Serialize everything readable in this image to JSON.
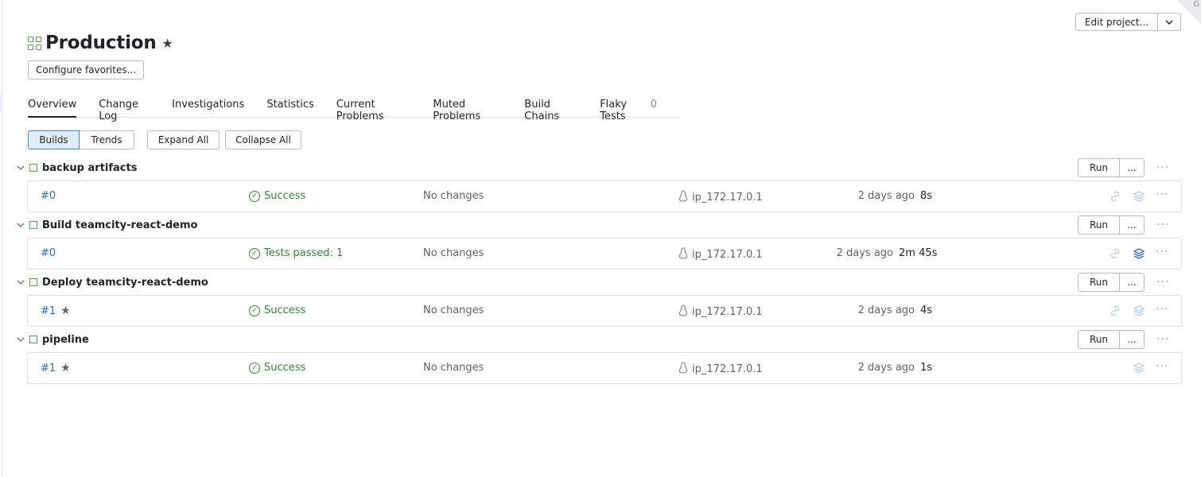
{
  "corner_glyph": "G",
  "header": {
    "edit_project": "Edit project...",
    "caret": "⌄"
  },
  "project": {
    "title": "Production",
    "star": "★"
  },
  "configure_favorites": "Configure favorites...",
  "tabs": [
    {
      "label": "Overview",
      "active": true
    },
    {
      "label": "Change Log"
    },
    {
      "label": "Investigations"
    },
    {
      "label": "Statistics"
    },
    {
      "label": "Current Problems"
    },
    {
      "label": "Muted Problems"
    },
    {
      "label": "Build Chains"
    },
    {
      "label": "Flaky Tests",
      "count": "0"
    }
  ],
  "toolbar": {
    "builds": "Builds",
    "trends": "Trends",
    "expand_all": "Expand All",
    "collapse_all": "Collapse All"
  },
  "run_label": "Run",
  "more_label": "...",
  "dots": "···",
  "check": "✓",
  "build_types": [
    {
      "name": "backup artifacts",
      "build": {
        "number": "#0",
        "starred": false,
        "status": "Success",
        "changes": "No changes",
        "agent": "ip_172.17.0.1",
        "time": "2 days ago",
        "duration": "8s",
        "link_icon": true,
        "layers_active": false
      }
    },
    {
      "name": "Build teamcity-react-demo",
      "build": {
        "number": "#0",
        "starred": false,
        "status": "Tests passed: 1",
        "changes": "No changes",
        "agent": "ip_172.17.0.1",
        "time": "2 days ago",
        "duration": "2m 45s",
        "link_icon": true,
        "layers_active": true
      }
    },
    {
      "name": "Deploy teamcity-react-demo",
      "build": {
        "number": "#1",
        "starred": true,
        "status": "Success",
        "changes": "No changes",
        "agent": "ip_172.17.0.1",
        "time": "2 days ago",
        "duration": "4s",
        "link_icon": true,
        "layers_active": false
      }
    },
    {
      "name": "pipeline",
      "build": {
        "number": "#1",
        "starred": true,
        "status": "Success",
        "changes": "No changes",
        "agent": "ip_172.17.0.1",
        "time": "2 days ago",
        "duration": "1s",
        "link_icon": false,
        "layers_active": false
      }
    }
  ],
  "icons": {
    "project": "project-grid-icon",
    "link": "link-icon",
    "layers": "layers-icon",
    "agent": "linux-agent-icon"
  },
  "colors": {
    "success": "#2b8a2b",
    "link": "#2970c0",
    "accent": "#3d8be0"
  }
}
